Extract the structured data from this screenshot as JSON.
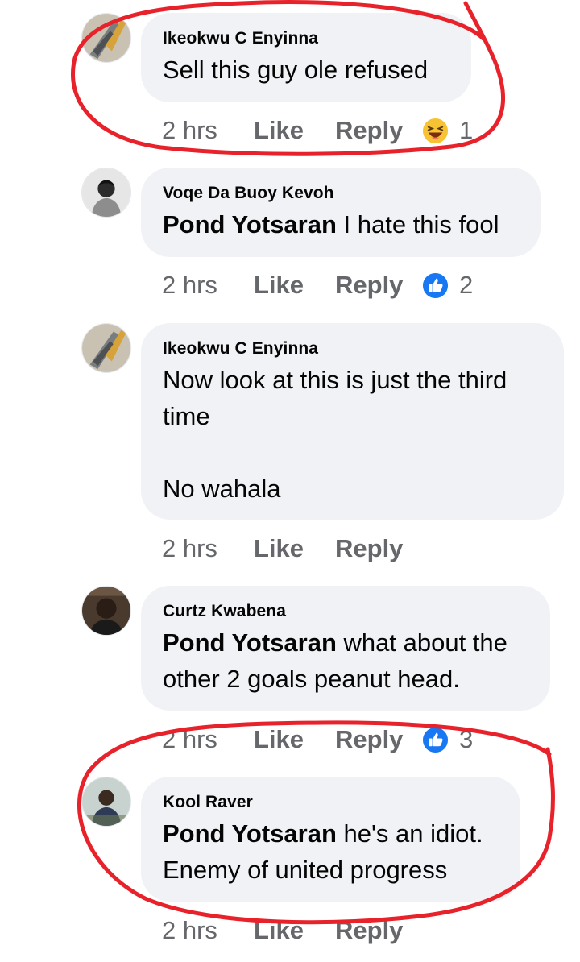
{
  "comments": [
    {
      "author": "Ikeokwu C Enyinna",
      "mention": "",
      "text": "Sell this guy ole refused",
      "time": "2 hrs",
      "like": "Like",
      "reply": "Reply",
      "reaction_icon": "haha-emoji-icon",
      "reaction_count": "1"
    },
    {
      "author": "Voqe Da Buoy Kevoh",
      "mention": "Pond Yotsaran",
      "text": " I hate this fool",
      "time": "2 hrs",
      "like": "Like",
      "reply": "Reply",
      "reaction_icon": "like-thumb-icon",
      "reaction_count": "2"
    },
    {
      "author": "Ikeokwu C Enyinna",
      "mention": "",
      "text": "Now look at this is just the third\ntime\n\nNo wahala",
      "time": "2 hrs",
      "like": "Like",
      "reply": "Reply",
      "reaction_icon": "",
      "reaction_count": ""
    },
    {
      "author": "Curtz Kwabena",
      "mention": "Pond Yotsaran",
      "text": " what about the\nother 2 goals peanut head.",
      "time": "2 hrs",
      "like": "Like",
      "reply": "Reply",
      "reaction_icon": "like-thumb-icon",
      "reaction_count": "3"
    },
    {
      "author": "Kool Raver",
      "mention": "Pond Yotsaran",
      "text": " he's an idiot.\nEnemy of united progress",
      "time": "2 hrs",
      "like": "Like",
      "reply": "Reply",
      "reaction_icon": "",
      "reaction_count": ""
    }
  ],
  "colors": {
    "bubble_bg": "#f0f2f5",
    "meta_text": "#65676b",
    "author_text": "#050505",
    "annotation_red": "#e8222a",
    "like_blue": "#1877f2"
  }
}
